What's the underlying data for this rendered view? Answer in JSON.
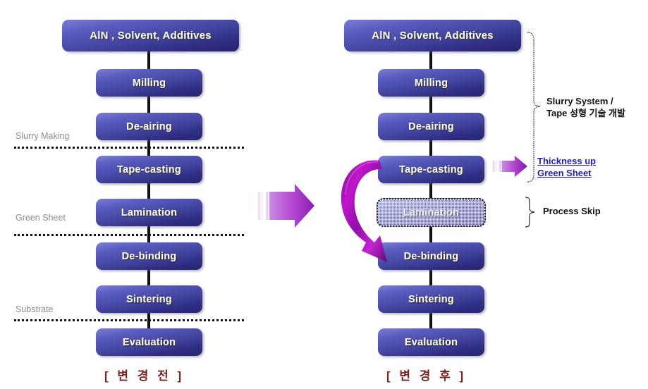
{
  "diagram": {
    "left": {
      "caption": "[ 변 경  전 ]",
      "boxes": [
        {
          "label": "AlN , Solvent, Additives"
        },
        {
          "label": "Milling"
        },
        {
          "label": "De-airing"
        },
        {
          "label": "Tape-casting"
        },
        {
          "label": "Lamination"
        },
        {
          "label": "De-binding"
        },
        {
          "label": "Sintering"
        },
        {
          "label": "Evaluation"
        }
      ],
      "stages": [
        {
          "label": "Slurry Making"
        },
        {
          "label": "Green Sheet"
        },
        {
          "label": "Substrate"
        }
      ]
    },
    "right": {
      "caption": "[ 변 경  후 ]",
      "boxes": [
        {
          "label": "AlN , Solvent, Additives"
        },
        {
          "label": "Milling"
        },
        {
          "label": "De-airing"
        },
        {
          "label": "Tape-casting"
        },
        {
          "label": "Lamination"
        },
        {
          "label": "De-binding"
        },
        {
          "label": "Sintering"
        },
        {
          "label": "Evaluation"
        }
      ],
      "annotations": [
        {
          "line1": "Slurry System /",
          "line2": "Tape 성형 기술 개발"
        },
        {
          "line1": "Thickness up",
          "line2": "Green Sheet"
        },
        {
          "line1": "Process Skip",
          "line2": ""
        }
      ]
    },
    "colors": {
      "box_light": "#7b7fd4",
      "box_dark": "#262472",
      "arrow_purple": "#a13fd0",
      "arrow_magenta": "#c014c8",
      "link_blue": "#1f1fb4",
      "caption_red": "#7a2020",
      "stage_gray": "#8c8c8c"
    }
  }
}
